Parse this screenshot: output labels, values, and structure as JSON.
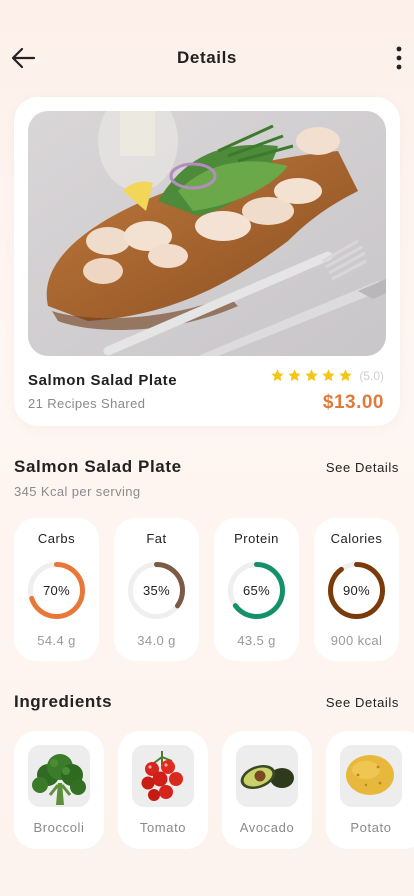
{
  "header": {
    "title": "Details",
    "back_icon": "arrow-left-icon",
    "more_icon": "more-vertical-icon"
  },
  "dish": {
    "name": "Salmon Salad Plate",
    "recipes": "21 Recipes Shared",
    "rating_stars": 5,
    "rating_text": "(5.0)",
    "price": "$13.00"
  },
  "nutrition": {
    "title": "Salmon Salad Plate",
    "see_details": "See Details",
    "subtitle": "345 Kcal per serving",
    "items": [
      {
        "label": "Carbs",
        "percent_text": "70%",
        "percent": 70,
        "amount": "54.4 g",
        "color": "#e8783a"
      },
      {
        "label": "Fat",
        "percent_text": "35%",
        "percent": 35,
        "amount": "34.0 g",
        "color": "#7b5a46"
      },
      {
        "label": "Protein",
        "percent_text": "65%",
        "percent": 65,
        "amount": "43.5 g",
        "color": "#14916a"
      },
      {
        "label": "Calories",
        "percent_text": "90%",
        "percent": 90,
        "amount": "900 kcal",
        "color": "#7a3a0a"
      }
    ]
  },
  "ingredients": {
    "title": "Ingredients",
    "see_details": "See Details",
    "items": [
      {
        "label": "Broccoli",
        "icon": "broccoli-icon"
      },
      {
        "label": "Tomato",
        "icon": "tomato-icon"
      },
      {
        "label": "Avocado",
        "icon": "avocado-icon"
      },
      {
        "label": "Potato",
        "icon": "potato-icon"
      }
    ]
  },
  "colors": {
    "accent": "#e07a3a",
    "star": "#f6c417",
    "muted": "#8a8a8a"
  }
}
